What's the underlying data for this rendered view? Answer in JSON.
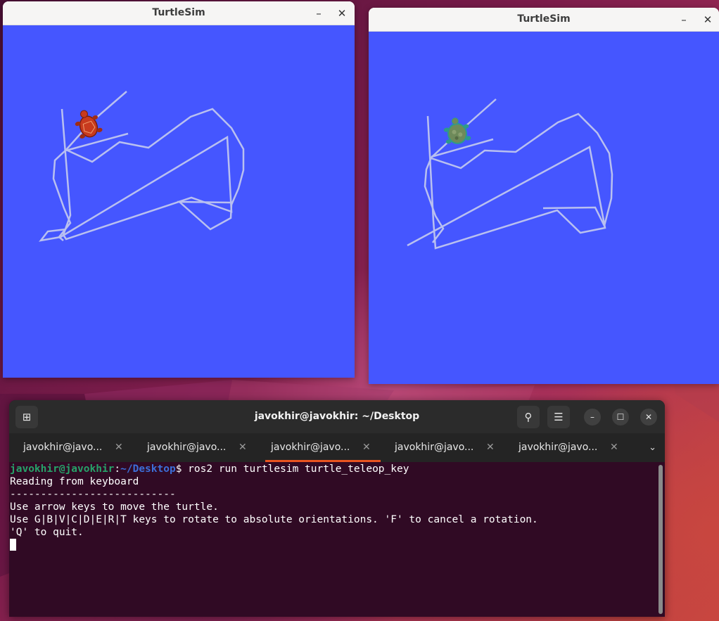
{
  "windows": [
    {
      "title": "TurtleSim",
      "turtle_color": "#c83a1e",
      "canvas_color": "#4556ff",
      "trail_color": "#b9c0f0"
    },
    {
      "title": "TurtleSim",
      "turtle_color": "#5a7a4a",
      "canvas_color": "#4556ff",
      "trail_color": "#b9c0f0"
    }
  ],
  "window_controls": {
    "minimize_icon": "minimize-icon",
    "close_icon": "close-icon"
  },
  "terminal": {
    "title": "javokhir@javokhir: ~/Desktop",
    "tabs": [
      {
        "label": "javokhir@javo...",
        "active": false
      },
      {
        "label": "javokhir@javo...",
        "active": false
      },
      {
        "label": "javokhir@javo...",
        "active": true
      },
      {
        "label": "javokhir@javo...",
        "active": false
      },
      {
        "label": "javokhir@javo...",
        "active": false
      }
    ],
    "accent_color": "#e95420",
    "background_color": "#300a24",
    "prompt": {
      "user_host": "javokhir@javokhir",
      "separator": ":",
      "path": "~/Desktop",
      "symbol": "$",
      "command": " ros2 run turtlesim turtle_teleop_key"
    },
    "output": [
      "Reading from keyboard",
      "---------------------------",
      "Use arrow keys to move the turtle.",
      "Use G|B|V|C|D|E|R|T keys to rotate to absolute orientations. 'F' to cancel a rotation.",
      "'Q' to quit."
    ]
  }
}
